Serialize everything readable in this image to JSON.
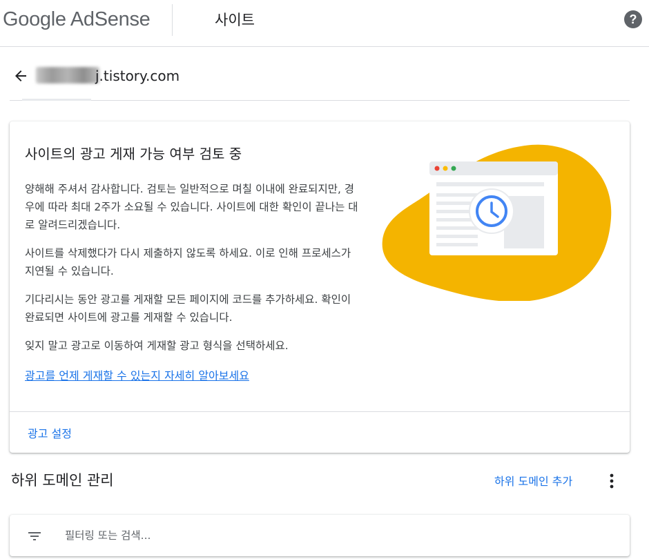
{
  "header": {
    "logo_google": "Google",
    "logo_adsense": " AdSense",
    "page_title": "사이트",
    "help_symbol": "?"
  },
  "breadcrumb": {
    "site_name": "j.tistory.com"
  },
  "review_card": {
    "title": "사이트의 광고 게재 가능 여부 검토 중",
    "paragraphs": [
      "양해해 주셔서 감사합니다. 검토는 일반적으로 며칠 이내에 완료되지만, 경우에 따라 최대 2주가 소요될 수 있습니다. 사이트에 대한 확인이 끝나는 대로 알려드리겠습니다.",
      "사이트를 삭제했다가 다시 제출하지 않도록 하세요. 이로 인해 프로세스가 지연될 수 있습니다.",
      "기다리시는 동안 광고를 게재할 모든 페이지에 코드를 추가하세요. 확인이 완료되면 사이트에 광고를 게재할 수 있습니다.",
      "잊지 말고 광고로 이동하여 게재할 광고 형식을 선택하세요."
    ],
    "learn_more_link": "광고를 언제 게재할 수 있는지 자세히 알아보세요",
    "footer_button": "광고 설정"
  },
  "subdomain_section": {
    "title": "하위 도메인 관리",
    "add_button": "하위 도메인 추가",
    "filter_placeholder": "필터링 또는 검색..."
  },
  "icons": {
    "back": "arrow-back-icon",
    "help": "help-icon",
    "more": "more-vert-icon",
    "filter": "filter-list-icon",
    "illustration": "review-clock-illustration"
  },
  "colors": {
    "accent_blue": "#1a73e8",
    "illustration_yellow": "#f4b400",
    "clock_blue": "#4285f4",
    "dot_red": "#ea4335",
    "dot_yellow": "#fbbc04",
    "dot_green": "#34a853"
  }
}
